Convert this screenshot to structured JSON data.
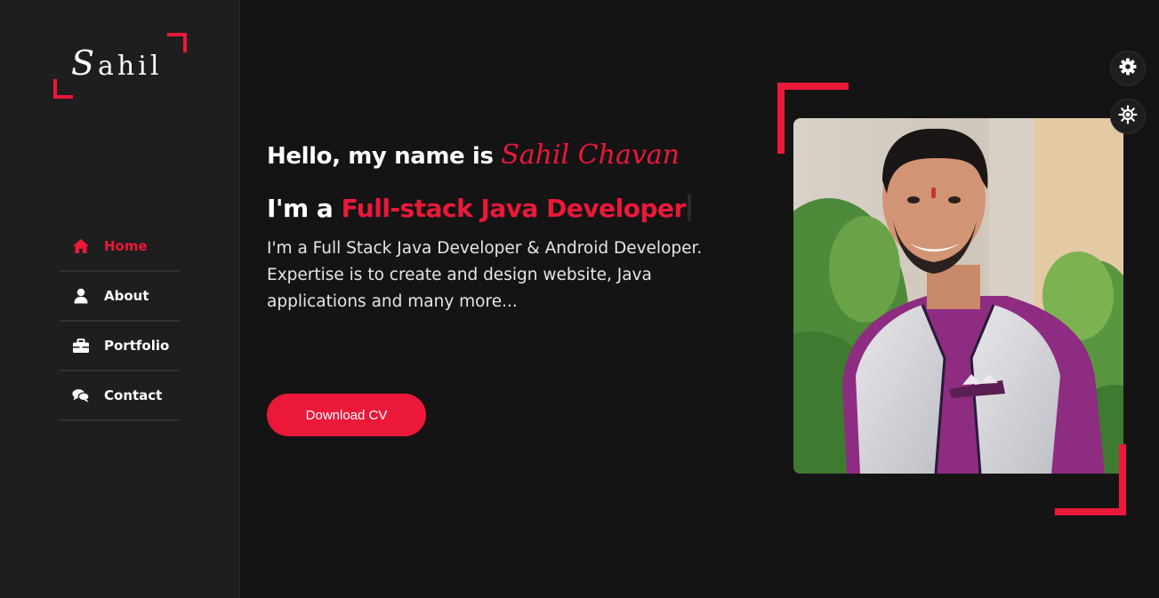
{
  "logo": {
    "first": "S",
    "rest": "ahil"
  },
  "nav": {
    "items": [
      {
        "label": "Home",
        "icon": "home-icon"
      },
      {
        "label": "About",
        "icon": "user-icon"
      },
      {
        "label": "Portfolio",
        "icon": "briefcase-icon"
      },
      {
        "label": "Contact",
        "icon": "comments-icon"
      }
    ]
  },
  "hero": {
    "greeting": "Hello, my name is ",
    "name": "Sahil Chavan",
    "role_prefix": "I'm a ",
    "role": "Full-stack Java Developer",
    "description": "I'm a Full Stack Java Developer & Android Developer. Expertise is to create and design website, Java applications and many more...",
    "cta": "Download CV"
  },
  "widgets": {
    "settings_icon": "cog-icon",
    "theme_icon": "sun-icon"
  },
  "colors": {
    "accent": "#ec1839",
    "background": "#151415",
    "sidebar": "#1f1e1f"
  }
}
